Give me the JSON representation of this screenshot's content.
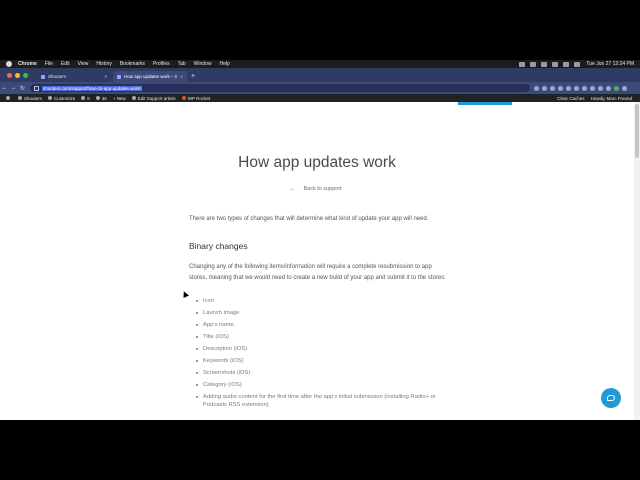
{
  "menubar": {
    "app": "Chrome",
    "items": [
      "File",
      "Edit",
      "View",
      "History",
      "Bookmarks",
      "Profiles",
      "Tab",
      "Window",
      "Help"
    ],
    "clock": "Tue Jun 27  12:24 PM"
  },
  "tabs": [
    {
      "title": "Shoutem",
      "active": false
    },
    {
      "title": "How app updates work – Shou",
      "active": true
    }
  ],
  "address": {
    "url": "shoutem.com/support/how-do-app-updates-work/"
  },
  "wpbar": {
    "site": "Shoutem",
    "customize": "Customize",
    "comments": "6",
    "updates": "36",
    "new": "+ New",
    "edit": "Edit Support article",
    "rocket": "WP Rocket",
    "clear": "Clear Caches",
    "howdy": "Howdy, Marc Freund"
  },
  "article": {
    "title": "How app updates work",
    "back": "Back to support",
    "intro": "There are two types of changes that will determine what kind of update your app will need.",
    "heading": "Binary changes",
    "para": "Changing any of the following items/information will require a complete resubmission to app stores, meaning that we would need to create a new build of your app and submit it to the stores:",
    "items": [
      "Icon",
      "Launch image",
      "App’s name,",
      "Title (iOS)",
      "Description (iOS)",
      "Keywords (iOS)",
      "Screenshots (iOS)",
      "Category (iOS)",
      "Adding audio content for the first time after the app’s initial submission (installing Radio+ or Podcasts RSS extension)"
    ]
  }
}
